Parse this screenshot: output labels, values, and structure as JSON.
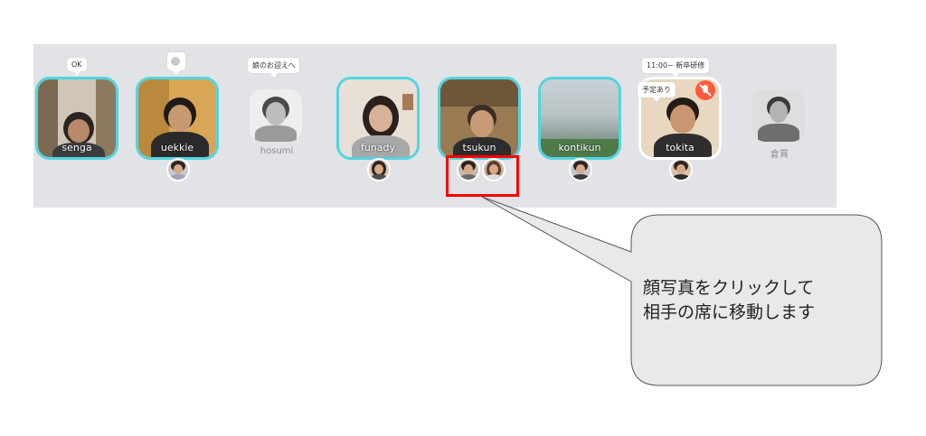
{
  "participants": [
    {
      "name": "senga",
      "status": "OK"
    },
    {
      "name": "uekkie",
      "status": ""
    },
    {
      "name": "hosumi",
      "status": "娘のお迎えへ"
    },
    {
      "name": "funady",
      "status": ""
    },
    {
      "name": "tsukun",
      "status": ""
    },
    {
      "name": "kontikun",
      "status": ""
    },
    {
      "name": "tokita",
      "status": "11:00~ 新卒研修",
      "status2": "予定あり"
    },
    {
      "name": "倉貫",
      "status": ""
    }
  ],
  "callout": {
    "line1": "顔写真をクリックして",
    "line2": "相手の席に移動します"
  },
  "colors": {
    "active_border": "#52d4e0",
    "highlight": "#ff0000",
    "no_mic": "#ff5a3c"
  }
}
